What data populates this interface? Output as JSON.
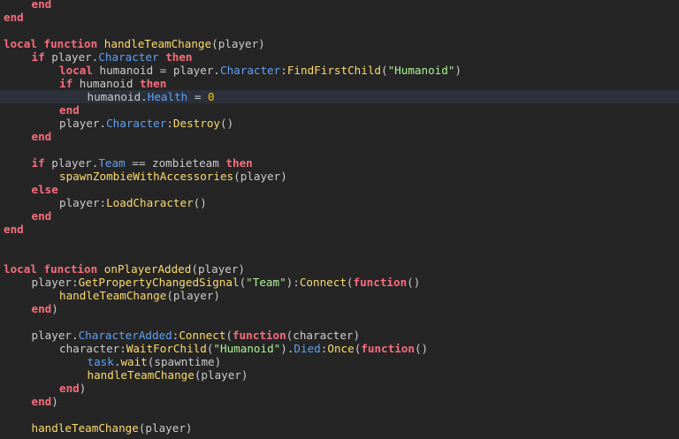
{
  "editor": {
    "current_line_index": 7,
    "colors": {
      "background": "#252526",
      "current_line": "#2b303b",
      "keyword": "#f86d7c",
      "function_name": "#fddb6d",
      "property": "#61a1f1",
      "string": "#adf195",
      "number": "#ffc600",
      "text": "#cccccc"
    },
    "lines": [
      {
        "indent": 1,
        "tokens": [
          {
            "t": "end",
            "c": "kw"
          }
        ]
      },
      {
        "indent": 0,
        "tokens": [
          {
            "t": "end",
            "c": "kw"
          }
        ]
      },
      {
        "indent": 0,
        "tokens": []
      },
      {
        "indent": 0,
        "tokens": [
          {
            "t": "local",
            "c": "kw"
          },
          {
            "t": " ",
            "c": "plain"
          },
          {
            "t": "function",
            "c": "kw"
          },
          {
            "t": " ",
            "c": "plain"
          },
          {
            "t": "handleTeamChange",
            "c": "fn"
          },
          {
            "t": "(player)",
            "c": "plain"
          }
        ]
      },
      {
        "indent": 1,
        "tokens": [
          {
            "t": "if",
            "c": "kw"
          },
          {
            "t": " player.",
            "c": "plain"
          },
          {
            "t": "Character",
            "c": "prop"
          },
          {
            "t": " ",
            "c": "plain"
          },
          {
            "t": "then",
            "c": "kw"
          }
        ]
      },
      {
        "indent": 2,
        "tokens": [
          {
            "t": "local",
            "c": "kw"
          },
          {
            "t": " humanoid = player.",
            "c": "plain"
          },
          {
            "t": "Character",
            "c": "prop"
          },
          {
            "t": ":",
            "c": "plain"
          },
          {
            "t": "FindFirstChild",
            "c": "fn"
          },
          {
            "t": "(",
            "c": "plain"
          },
          {
            "t": "\"Humanoid\"",
            "c": "str"
          },
          {
            "t": ")",
            "c": "plain"
          }
        ]
      },
      {
        "indent": 2,
        "tokens": [
          {
            "t": "if",
            "c": "kw"
          },
          {
            "t": " humanoid ",
            "c": "plain"
          },
          {
            "t": "then",
            "c": "kw"
          }
        ]
      },
      {
        "indent": 3,
        "tokens": [
          {
            "t": "humanoid.",
            "c": "plain"
          },
          {
            "t": "Health",
            "c": "prop"
          },
          {
            "t": " = ",
            "c": "plain"
          },
          {
            "t": "0",
            "c": "num"
          }
        ]
      },
      {
        "indent": 2,
        "tokens": [
          {
            "t": "end",
            "c": "kw"
          }
        ]
      },
      {
        "indent": 2,
        "tokens": [
          {
            "t": "player.",
            "c": "plain"
          },
          {
            "t": "Character",
            "c": "prop"
          },
          {
            "t": ":",
            "c": "plain"
          },
          {
            "t": "Destroy",
            "c": "fn"
          },
          {
            "t": "()",
            "c": "plain"
          }
        ]
      },
      {
        "indent": 1,
        "tokens": [
          {
            "t": "end",
            "c": "kw"
          }
        ]
      },
      {
        "indent": 0,
        "tokens": []
      },
      {
        "indent": 1,
        "tokens": [
          {
            "t": "if",
            "c": "kw"
          },
          {
            "t": " player.",
            "c": "plain"
          },
          {
            "t": "Team",
            "c": "prop"
          },
          {
            "t": " == zombieteam ",
            "c": "plain"
          },
          {
            "t": "then",
            "c": "kw"
          }
        ]
      },
      {
        "indent": 2,
        "tokens": [
          {
            "t": "spawnZombieWithAccessories",
            "c": "fn"
          },
          {
            "t": "(player)",
            "c": "plain"
          }
        ]
      },
      {
        "indent": 1,
        "tokens": [
          {
            "t": "else",
            "c": "kw"
          }
        ]
      },
      {
        "indent": 2,
        "tokens": [
          {
            "t": "player:",
            "c": "plain"
          },
          {
            "t": "LoadCharacter",
            "c": "fn"
          },
          {
            "t": "()",
            "c": "plain"
          }
        ]
      },
      {
        "indent": 1,
        "tokens": [
          {
            "t": "end",
            "c": "kw"
          }
        ]
      },
      {
        "indent": 0,
        "tokens": [
          {
            "t": "end",
            "c": "kw"
          }
        ]
      },
      {
        "indent": 0,
        "tokens": []
      },
      {
        "indent": 0,
        "tokens": []
      },
      {
        "indent": 0,
        "tokens": [
          {
            "t": "local",
            "c": "kw"
          },
          {
            "t": " ",
            "c": "plain"
          },
          {
            "t": "function",
            "c": "kw"
          },
          {
            "t": " ",
            "c": "plain"
          },
          {
            "t": "onPlayerAdded",
            "c": "fn"
          },
          {
            "t": "(player)",
            "c": "plain"
          }
        ]
      },
      {
        "indent": 1,
        "tokens": [
          {
            "t": "player:",
            "c": "plain"
          },
          {
            "t": "GetPropertyChangedSignal",
            "c": "fn"
          },
          {
            "t": "(",
            "c": "plain"
          },
          {
            "t": "\"Team\"",
            "c": "str"
          },
          {
            "t": "):",
            "c": "plain"
          },
          {
            "t": "Connect",
            "c": "fn"
          },
          {
            "t": "(",
            "c": "plain"
          },
          {
            "t": "function",
            "c": "kw"
          },
          {
            "t": "()",
            "c": "plain"
          }
        ]
      },
      {
        "indent": 2,
        "tokens": [
          {
            "t": "handleTeamChange",
            "c": "fn"
          },
          {
            "t": "(player)",
            "c": "plain"
          }
        ]
      },
      {
        "indent": 1,
        "tokens": [
          {
            "t": "end",
            "c": "kw"
          },
          {
            "t": ")",
            "c": "plain"
          }
        ]
      },
      {
        "indent": 0,
        "tokens": []
      },
      {
        "indent": 1,
        "tokens": [
          {
            "t": "player.",
            "c": "plain"
          },
          {
            "t": "CharacterAdded",
            "c": "prop"
          },
          {
            "t": ":",
            "c": "plain"
          },
          {
            "t": "Connect",
            "c": "fn"
          },
          {
            "t": "(",
            "c": "plain"
          },
          {
            "t": "function",
            "c": "kw"
          },
          {
            "t": "(character)",
            "c": "plain"
          }
        ]
      },
      {
        "indent": 2,
        "tokens": [
          {
            "t": "character:",
            "c": "plain"
          },
          {
            "t": "WaitForChild",
            "c": "fn"
          },
          {
            "t": "(",
            "c": "plain"
          },
          {
            "t": "\"Humanoid\"",
            "c": "str"
          },
          {
            "t": ").",
            "c": "plain"
          },
          {
            "t": "Died",
            "c": "prop"
          },
          {
            "t": ":",
            "c": "plain"
          },
          {
            "t": "Once",
            "c": "fn"
          },
          {
            "t": "(",
            "c": "plain"
          },
          {
            "t": "function",
            "c": "kw"
          },
          {
            "t": "()",
            "c": "plain"
          }
        ]
      },
      {
        "indent": 3,
        "tokens": [
          {
            "t": "task",
            "c": "prop"
          },
          {
            "t": ".",
            "c": "plain"
          },
          {
            "t": "wait",
            "c": "fn"
          },
          {
            "t": "(spawntime)",
            "c": "plain"
          }
        ]
      },
      {
        "indent": 3,
        "tokens": [
          {
            "t": "handleTeamChange",
            "c": "fn"
          },
          {
            "t": "(player)",
            "c": "plain"
          }
        ]
      },
      {
        "indent": 2,
        "tokens": [
          {
            "t": "end",
            "c": "kw"
          },
          {
            "t": ")",
            "c": "plain"
          }
        ]
      },
      {
        "indent": 1,
        "tokens": [
          {
            "t": "end",
            "c": "kw"
          },
          {
            "t": ")",
            "c": "plain"
          }
        ]
      },
      {
        "indent": 0,
        "tokens": []
      },
      {
        "indent": 1,
        "tokens": [
          {
            "t": "handleTeamChange",
            "c": "fn"
          },
          {
            "t": "(player)",
            "c": "plain"
          }
        ]
      }
    ]
  }
}
